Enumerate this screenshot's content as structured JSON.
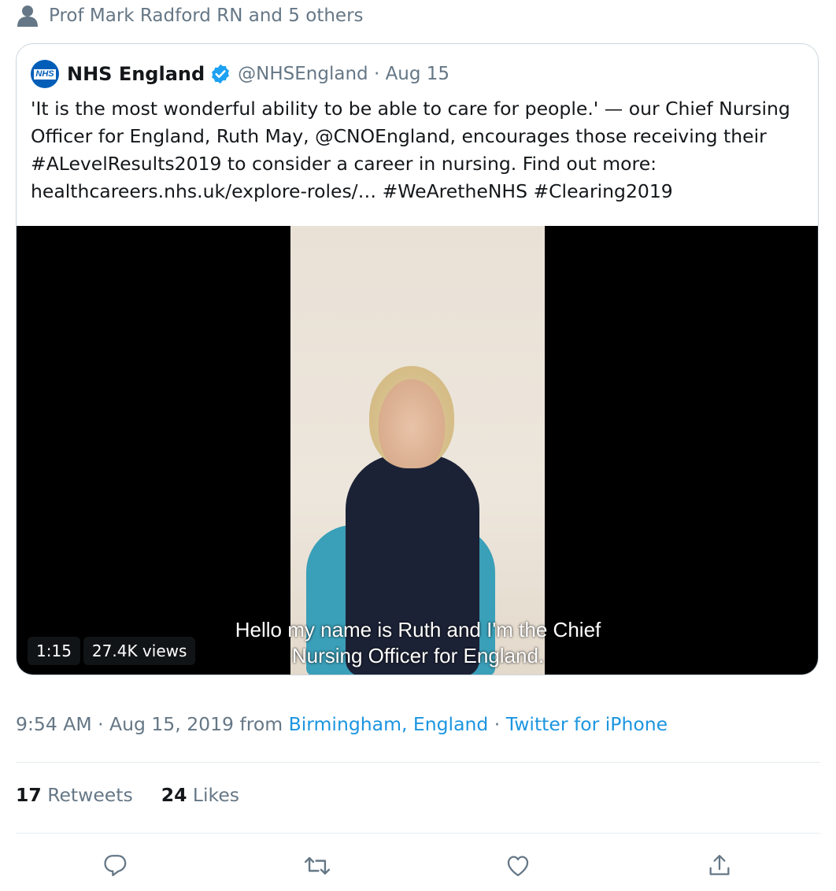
{
  "social_context": {
    "text": "Prof Mark Radford RN and 5 others",
    "icon": "person-icon"
  },
  "quoted_tweet": {
    "author_name": "NHS England",
    "avatar_text": "NHS",
    "handle_date": "@NHSEngland · Aug 15",
    "text": "'It is the most wonderful ability to be able to care for people.' — our Chief Nursing Officer for England, Ruth May, @CNOEngland, encourages those receiving their #ALevelResults2019 to consider a career in nursing. Find out more: healthcareers.nhs.uk/explore-roles/… #WeAretheNHS #Clearing2019",
    "video": {
      "caption": "Hello my name is Ruth and I'm the Chief Nursing Officer for England.",
      "duration": "1:15",
      "views": "27.4K views"
    }
  },
  "meta": {
    "time": "9:54 AM · Aug 15, 2019 from ",
    "location": "Birmingham, England",
    "separator": " · ",
    "source": "Twitter for iPhone"
  },
  "stats": {
    "retweets_count": "17",
    "retweets_label": "Retweets",
    "likes_count": "24",
    "likes_label": "Likes"
  },
  "colors": {
    "link": "#1b95e0",
    "muted": "#657786",
    "nhs_blue": "#005eb8"
  }
}
